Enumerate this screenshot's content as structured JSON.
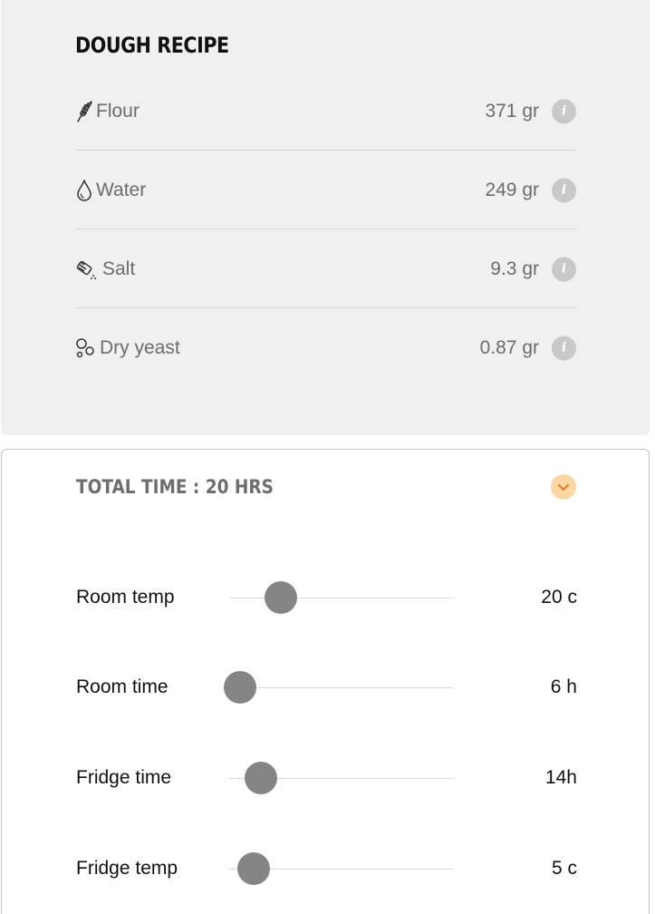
{
  "recipe": {
    "title": "DOUGH RECIPE",
    "ingredients": [
      {
        "icon": "wheat-icon",
        "name": "Flour",
        "amount": "371 gr",
        "info": "i"
      },
      {
        "icon": "water-drop-icon",
        "name": "Water",
        "amount": "249 gr",
        "info": "i"
      },
      {
        "icon": "salt-shaker-icon",
        "name": "Salt",
        "amount": "9.3 gr",
        "info": "i"
      },
      {
        "icon": "yeast-bubbles-icon",
        "name": "Dry yeast",
        "amount": "0.87 gr",
        "info": "i"
      }
    ]
  },
  "timing": {
    "total_label": "TOTAL TIME : 20 HRS",
    "toggle_icon": "chevron-down-icon",
    "accent_color": "#fcd7a4",
    "settings": [
      {
        "label": "Room temp",
        "value": "20 c",
        "slider_fraction": 0.23
      },
      {
        "label": "Room time",
        "value": "6 h",
        "slider_fraction": 0.05
      },
      {
        "label": "Fridge time",
        "value": "14h",
        "slider_fraction": 0.14
      },
      {
        "label": "Fridge temp",
        "value": "5 c",
        "slider_fraction": 0.11
      }
    ]
  }
}
